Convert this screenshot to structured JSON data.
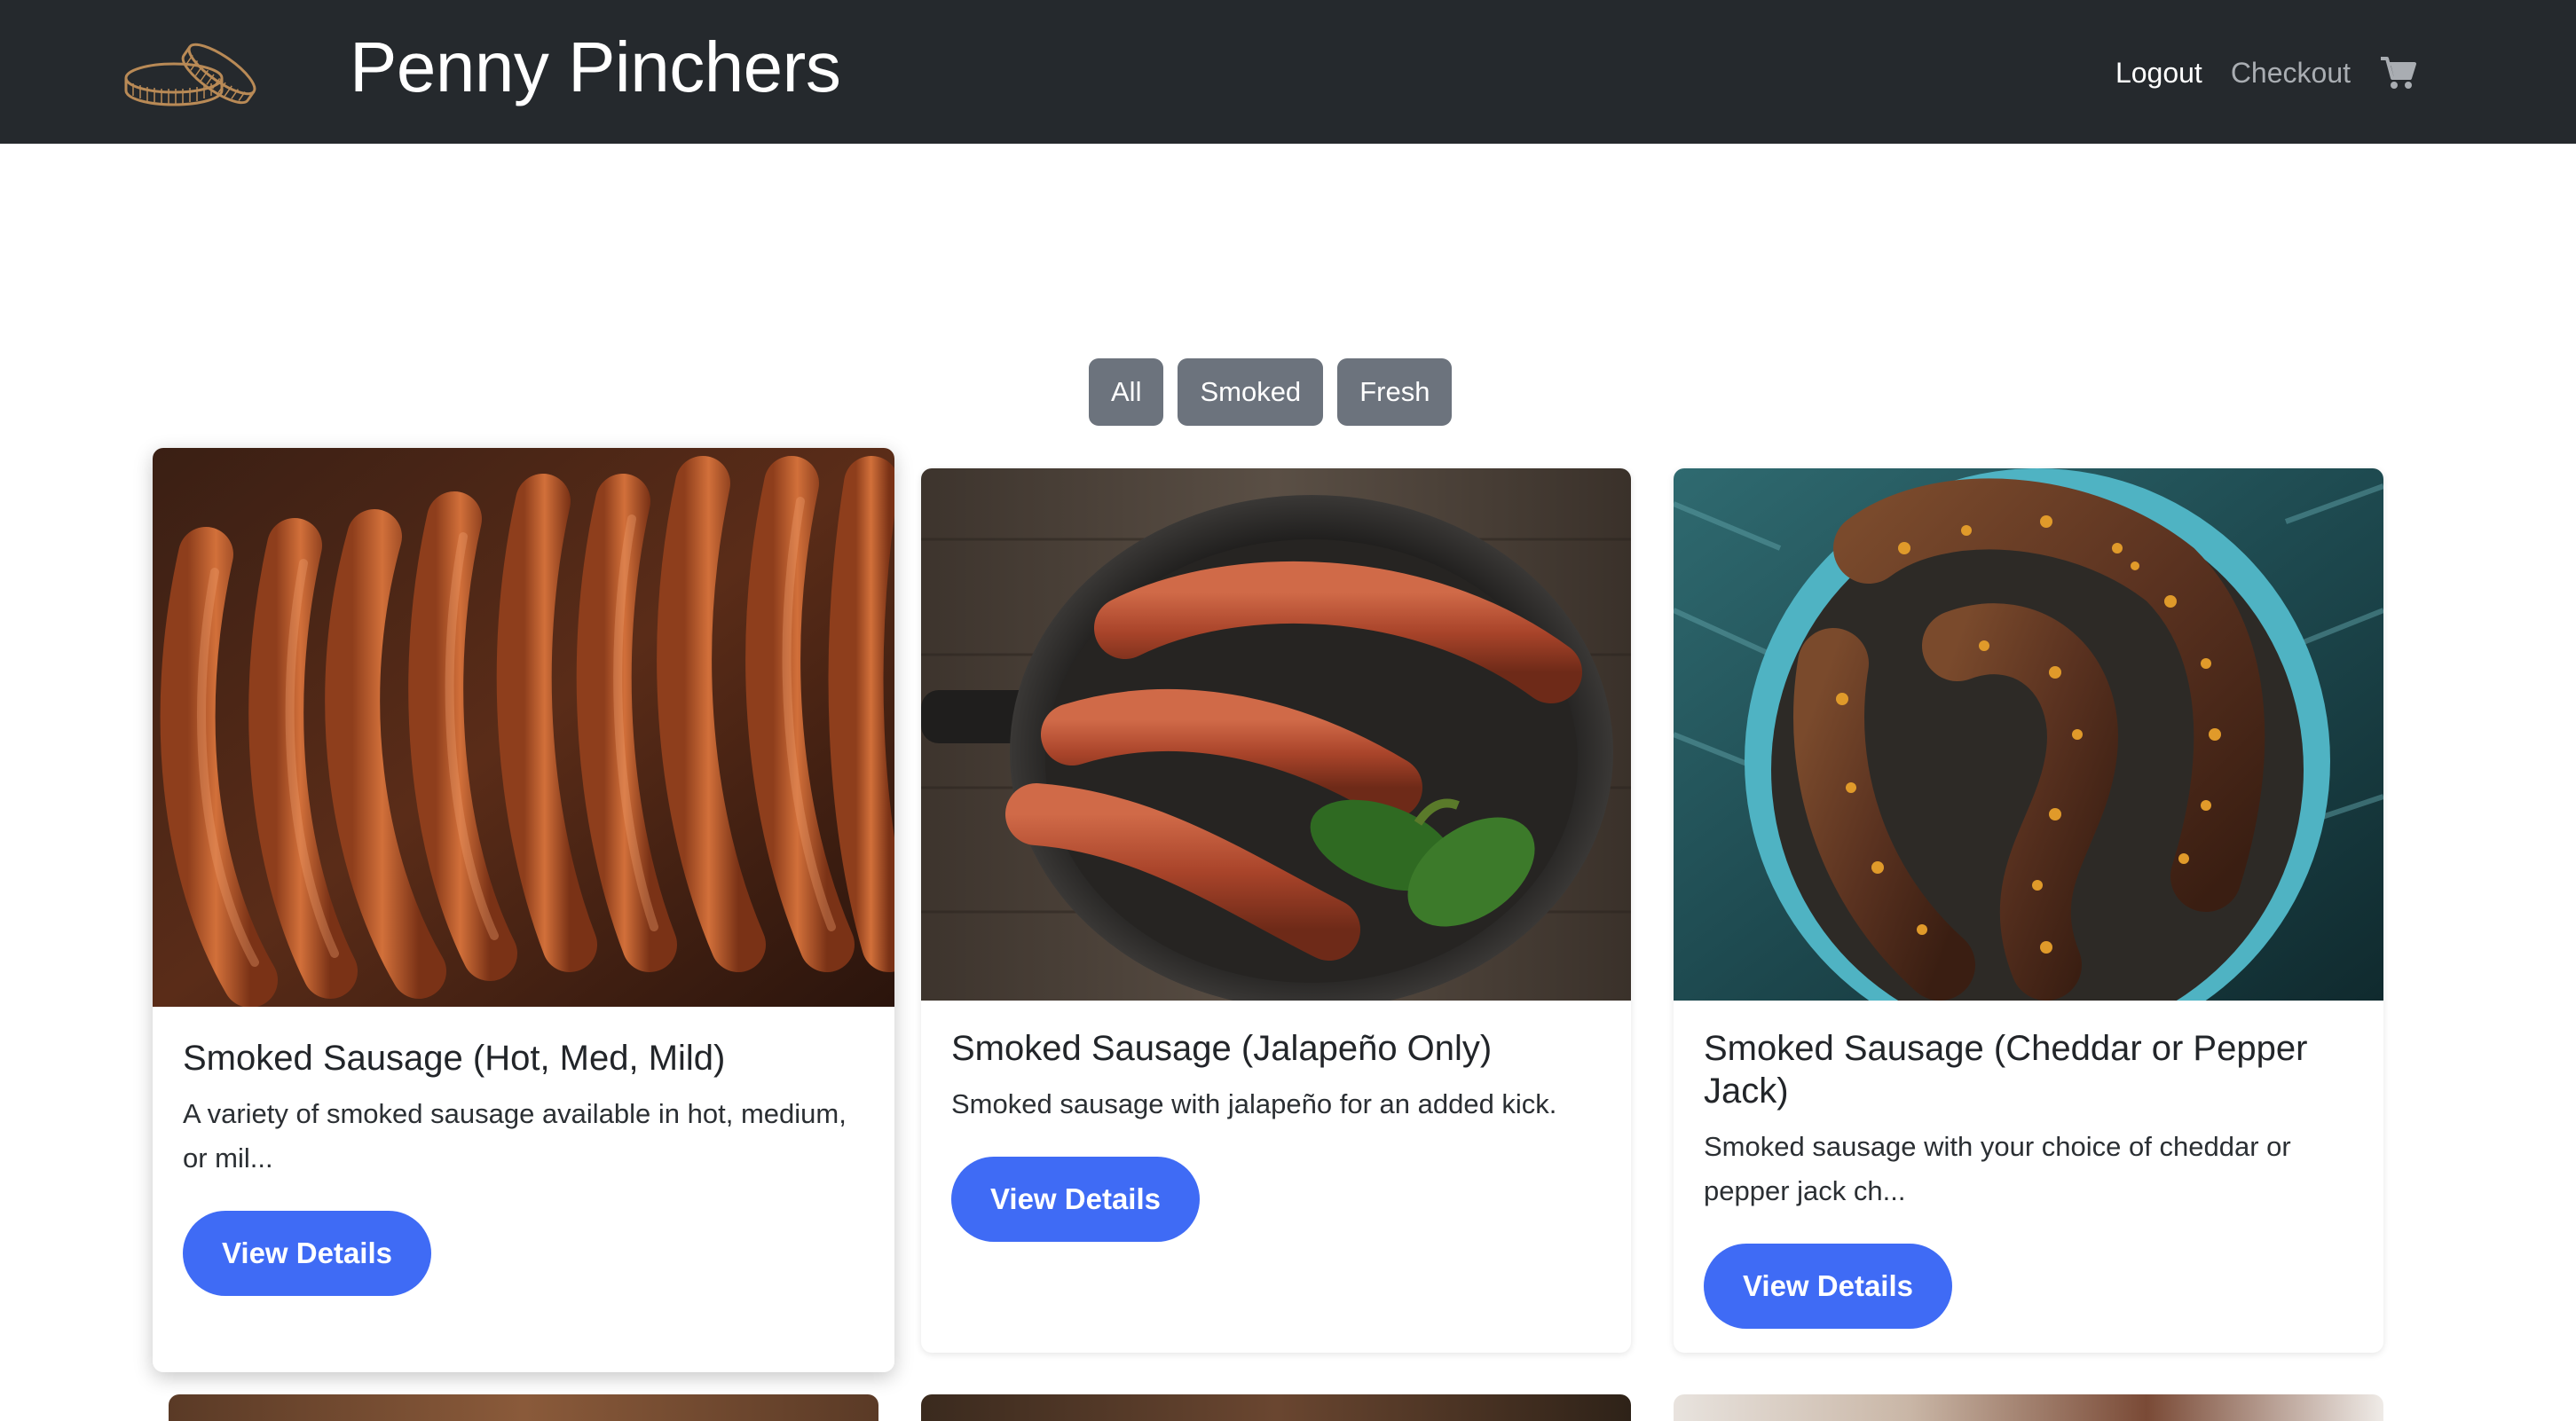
{
  "navbar": {
    "brand": "Penny Pinchers",
    "logo_icon": "coins-icon",
    "links": {
      "logout": "Logout",
      "checkout": "Checkout"
    },
    "cart_icon": "shopping-cart-icon",
    "background": "#25292d"
  },
  "filters": {
    "buttons": [
      "All",
      "Smoked",
      "Fresh"
    ],
    "color": "#6c737d"
  },
  "products": [
    {
      "title": "Smoked Sausage (Hot, Med, Mild)",
      "description": "A variety of smoked sausage available in hot, medium, or mil...",
      "button": "View Details",
      "image": "hanging-smoked-sausages-photo"
    },
    {
      "title": "Smoked Sausage (Jalapeño Only)",
      "description": "Smoked sausage with jalapeño for an added kick.",
      "button": "View Details",
      "image": "sausages-in-skillet-with-jalapenos-photo"
    },
    {
      "title": "Smoked Sausage (Cheddar or Pepper Jack)",
      "description": "Smoked sausage with your choice of cheddar or pepper jack ch...",
      "button": "View Details",
      "image": "cheddar-sausages-in-blue-bowl-photo"
    }
  ],
  "colors": {
    "primary_button": "#3f6bf5"
  }
}
